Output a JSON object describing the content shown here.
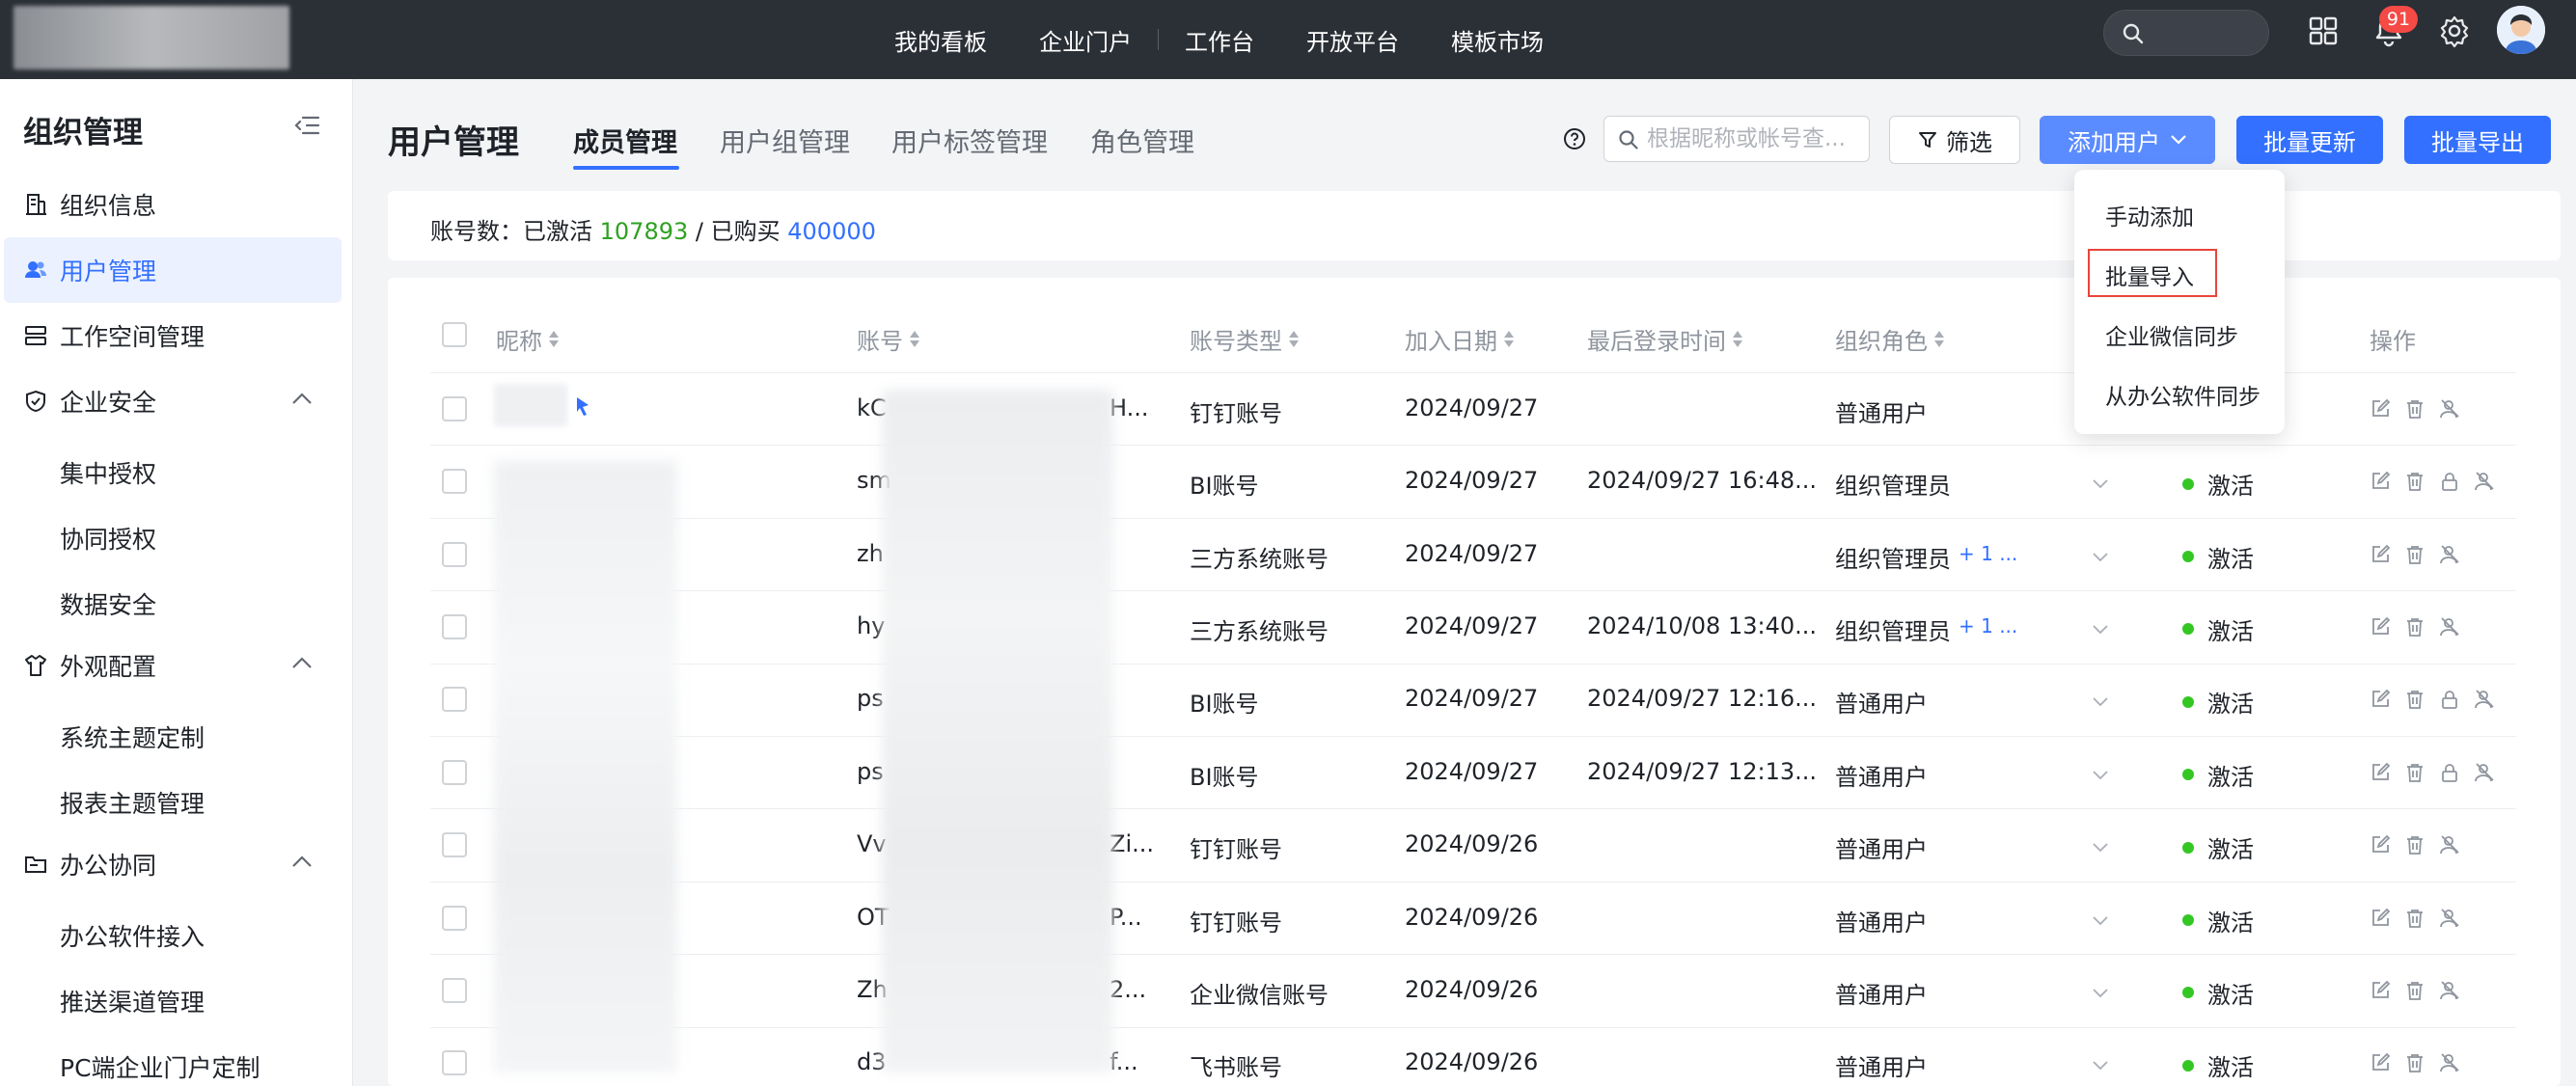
{
  "topbar": {
    "nav": [
      "我的看板",
      "企业门户",
      "工作台",
      "开放平台",
      "模板市场"
    ],
    "notification_count": "91"
  },
  "sidebar": {
    "title": "组织管理",
    "items": [
      {
        "label": "组织信息",
        "icon": "building-icon"
      },
      {
        "label": "用户管理",
        "icon": "users-icon",
        "active": true
      },
      {
        "label": "工作空间管理",
        "icon": "workspace-icon"
      },
      {
        "label": "企业安全",
        "icon": "shield-icon",
        "expanded": true,
        "children": [
          "集中授权",
          "协同授权",
          "数据安全"
        ]
      },
      {
        "label": "外观配置",
        "icon": "shirt-icon",
        "expanded": true,
        "children": [
          "系统主题定制",
          "报表主题管理"
        ]
      },
      {
        "label": "办公协同",
        "icon": "folder-icon",
        "expanded": true,
        "children": [
          "办公软件接入",
          "推送渠道管理",
          "PC端企业门户定制"
        ]
      }
    ]
  },
  "header": {
    "title": "用户管理",
    "tabs": [
      "成员管理",
      "用户组管理",
      "用户标签管理",
      "角色管理"
    ],
    "search_placeholder": "根据昵称或帐号查...",
    "filter_label": "筛选",
    "add_user_label": "添加用户",
    "batch_update_label": "批量更新",
    "batch_export_label": "批量导出"
  },
  "dropdown": {
    "items": [
      "手动添加",
      "批量导入",
      "企业微信同步",
      "从办公软件同步"
    ]
  },
  "counts": {
    "prefix": "账号数：已激活",
    "activated": "107893",
    "separator": "/ 已购买",
    "purchased": "400000"
  },
  "table": {
    "columns": [
      "昵称",
      "账号",
      "账号类型",
      "加入日期",
      "最后登录时间",
      "组织角色",
      "操作"
    ],
    "rows": [
      {
        "account": "kC",
        "account_tail": "H...",
        "type": "钉钉账号",
        "date": "2024/09/27",
        "last_login": "",
        "role": "普通用户",
        "role_extra": "",
        "status": "",
        "lock": false
      },
      {
        "account": "sm",
        "account_tail": "",
        "type": "BI账号",
        "date": "2024/09/27",
        "last_login": "2024/09/27 16:48...",
        "role": "组织管理员",
        "role_extra": "",
        "status": "激活",
        "lock": true
      },
      {
        "account": "zh",
        "account_tail": "",
        "type": "三方系统账号",
        "date": "2024/09/27",
        "last_login": "",
        "role": "组织管理员",
        "role_extra": "+ 1 ...",
        "status": "激活",
        "lock": false
      },
      {
        "account": "hy",
        "account_tail": "",
        "type": "三方系统账号",
        "date": "2024/09/27",
        "last_login": "2024/10/08 13:40...",
        "role": "组织管理员",
        "role_extra": "+ 1 ...",
        "status": "激活",
        "lock": false
      },
      {
        "account": "ps",
        "account_tail": "",
        "type": "BI账号",
        "date": "2024/09/27",
        "last_login": "2024/09/27 12:16...",
        "role": "普通用户",
        "role_extra": "",
        "status": "激活",
        "lock": true
      },
      {
        "account": "ps",
        "account_tail": "",
        "type": "BI账号",
        "date": "2024/09/27",
        "last_login": "2024/09/27 12:13...",
        "role": "普通用户",
        "role_extra": "",
        "status": "激活",
        "lock": true
      },
      {
        "account": "Vv",
        "account_tail": "Zi...",
        "type": "钉钉账号",
        "date": "2024/09/26",
        "last_login": "",
        "role": "普通用户",
        "role_extra": "",
        "status": "激活",
        "lock": false
      },
      {
        "account": "OT",
        "account_tail": "P...",
        "type": "钉钉账号",
        "date": "2024/09/26",
        "last_login": "",
        "role": "普通用户",
        "role_extra": "",
        "status": "激活",
        "lock": false
      },
      {
        "account": "Zh",
        "account_tail": "2...",
        "type": "企业微信账号",
        "date": "2024/09/26",
        "last_login": "",
        "role": "普通用户",
        "role_extra": "",
        "status": "激活",
        "lock": false
      },
      {
        "account": "d3",
        "account_tail": "f...",
        "type": "飞书账号",
        "date": "2024/09/26",
        "last_login": "",
        "role": "普通用户",
        "role_extra": "",
        "status": "激活",
        "lock": false
      }
    ]
  },
  "colors": {
    "accent": "#3370ff",
    "active_green": "#2ea121",
    "status_dot": "#34c724",
    "highlight_red": "#e8453c"
  }
}
